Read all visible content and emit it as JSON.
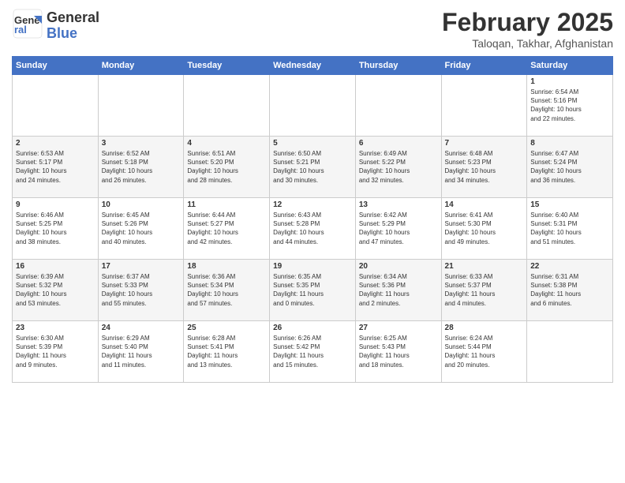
{
  "logo": {
    "general": "General",
    "blue": "Blue"
  },
  "title": "February 2025",
  "subtitle": "Taloqan, Takhar, Afghanistan",
  "headers": [
    "Sunday",
    "Monday",
    "Tuesday",
    "Wednesday",
    "Thursday",
    "Friday",
    "Saturday"
  ],
  "weeks": [
    [
      {
        "day": "",
        "info": ""
      },
      {
        "day": "",
        "info": ""
      },
      {
        "day": "",
        "info": ""
      },
      {
        "day": "",
        "info": ""
      },
      {
        "day": "",
        "info": ""
      },
      {
        "day": "",
        "info": ""
      },
      {
        "day": "1",
        "info": "Sunrise: 6:54 AM\nSunset: 5:16 PM\nDaylight: 10 hours\nand 22 minutes."
      }
    ],
    [
      {
        "day": "2",
        "info": "Sunrise: 6:53 AM\nSunset: 5:17 PM\nDaylight: 10 hours\nand 24 minutes."
      },
      {
        "day": "3",
        "info": "Sunrise: 6:52 AM\nSunset: 5:18 PM\nDaylight: 10 hours\nand 26 minutes."
      },
      {
        "day": "4",
        "info": "Sunrise: 6:51 AM\nSunset: 5:20 PM\nDaylight: 10 hours\nand 28 minutes."
      },
      {
        "day": "5",
        "info": "Sunrise: 6:50 AM\nSunset: 5:21 PM\nDaylight: 10 hours\nand 30 minutes."
      },
      {
        "day": "6",
        "info": "Sunrise: 6:49 AM\nSunset: 5:22 PM\nDaylight: 10 hours\nand 32 minutes."
      },
      {
        "day": "7",
        "info": "Sunrise: 6:48 AM\nSunset: 5:23 PM\nDaylight: 10 hours\nand 34 minutes."
      },
      {
        "day": "8",
        "info": "Sunrise: 6:47 AM\nSunset: 5:24 PM\nDaylight: 10 hours\nand 36 minutes."
      }
    ],
    [
      {
        "day": "9",
        "info": "Sunrise: 6:46 AM\nSunset: 5:25 PM\nDaylight: 10 hours\nand 38 minutes."
      },
      {
        "day": "10",
        "info": "Sunrise: 6:45 AM\nSunset: 5:26 PM\nDaylight: 10 hours\nand 40 minutes."
      },
      {
        "day": "11",
        "info": "Sunrise: 6:44 AM\nSunset: 5:27 PM\nDaylight: 10 hours\nand 42 minutes."
      },
      {
        "day": "12",
        "info": "Sunrise: 6:43 AM\nSunset: 5:28 PM\nDaylight: 10 hours\nand 44 minutes."
      },
      {
        "day": "13",
        "info": "Sunrise: 6:42 AM\nSunset: 5:29 PM\nDaylight: 10 hours\nand 47 minutes."
      },
      {
        "day": "14",
        "info": "Sunrise: 6:41 AM\nSunset: 5:30 PM\nDaylight: 10 hours\nand 49 minutes."
      },
      {
        "day": "15",
        "info": "Sunrise: 6:40 AM\nSunset: 5:31 PM\nDaylight: 10 hours\nand 51 minutes."
      }
    ],
    [
      {
        "day": "16",
        "info": "Sunrise: 6:39 AM\nSunset: 5:32 PM\nDaylight: 10 hours\nand 53 minutes."
      },
      {
        "day": "17",
        "info": "Sunrise: 6:37 AM\nSunset: 5:33 PM\nDaylight: 10 hours\nand 55 minutes."
      },
      {
        "day": "18",
        "info": "Sunrise: 6:36 AM\nSunset: 5:34 PM\nDaylight: 10 hours\nand 57 minutes."
      },
      {
        "day": "19",
        "info": "Sunrise: 6:35 AM\nSunset: 5:35 PM\nDaylight: 11 hours\nand 0 minutes."
      },
      {
        "day": "20",
        "info": "Sunrise: 6:34 AM\nSunset: 5:36 PM\nDaylight: 11 hours\nand 2 minutes."
      },
      {
        "day": "21",
        "info": "Sunrise: 6:33 AM\nSunset: 5:37 PM\nDaylight: 11 hours\nand 4 minutes."
      },
      {
        "day": "22",
        "info": "Sunrise: 6:31 AM\nSunset: 5:38 PM\nDaylight: 11 hours\nand 6 minutes."
      }
    ],
    [
      {
        "day": "23",
        "info": "Sunrise: 6:30 AM\nSunset: 5:39 PM\nDaylight: 11 hours\nand 9 minutes."
      },
      {
        "day": "24",
        "info": "Sunrise: 6:29 AM\nSunset: 5:40 PM\nDaylight: 11 hours\nand 11 minutes."
      },
      {
        "day": "25",
        "info": "Sunrise: 6:28 AM\nSunset: 5:41 PM\nDaylight: 11 hours\nand 13 minutes."
      },
      {
        "day": "26",
        "info": "Sunrise: 6:26 AM\nSunset: 5:42 PM\nDaylight: 11 hours\nand 15 minutes."
      },
      {
        "day": "27",
        "info": "Sunrise: 6:25 AM\nSunset: 5:43 PM\nDaylight: 11 hours\nand 18 minutes."
      },
      {
        "day": "28",
        "info": "Sunrise: 6:24 AM\nSunset: 5:44 PM\nDaylight: 11 hours\nand 20 minutes."
      },
      {
        "day": "",
        "info": ""
      }
    ]
  ]
}
